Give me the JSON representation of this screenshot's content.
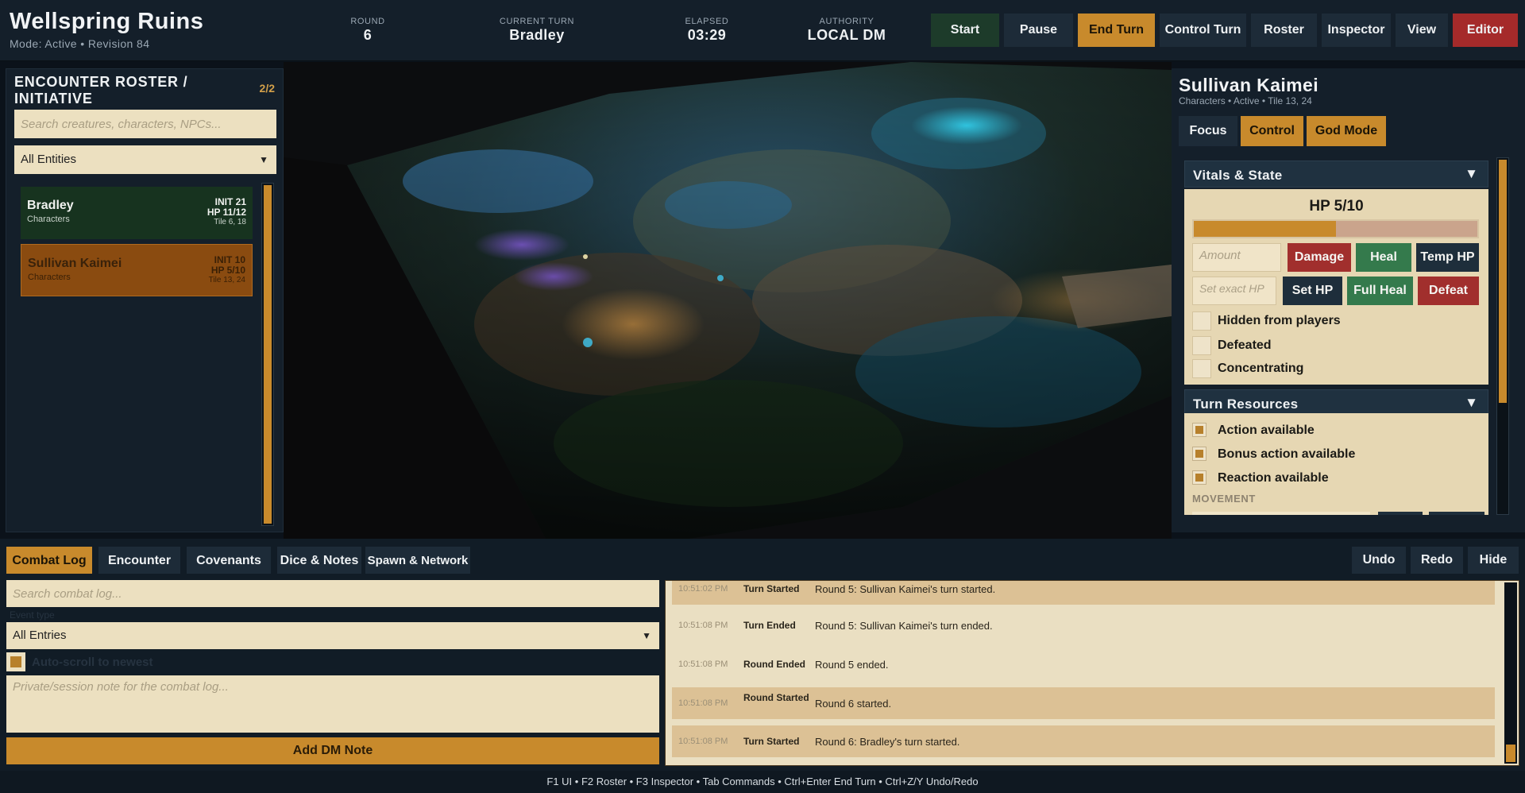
{
  "header": {
    "title": "Wellspring Ruins",
    "subtitle": "Mode: Active  •  Revision 84",
    "stats": [
      {
        "label": "ROUND",
        "value": "6"
      },
      {
        "label": "CURRENT TURN",
        "value": "Bradley"
      },
      {
        "label": "ELAPSED",
        "value": "03:29"
      },
      {
        "label": "AUTHORITY",
        "value": "LOCAL DM"
      }
    ],
    "buttons": {
      "start": "Start",
      "pause": "Pause",
      "end_turn": "End Turn",
      "control_turn": "Control Turn",
      "roster": "Roster",
      "inspector": "Inspector",
      "view": "View",
      "editor": "Editor"
    }
  },
  "roster": {
    "title": "ENCOUNTER ROSTER / INITIATIVE",
    "count": "2/2",
    "search_placeholder": "Search creatures, characters, NPCs...",
    "filter_value": "All Entities",
    "entities": [
      {
        "name": "Bradley",
        "class": "Characters",
        "init": "INIT 21",
        "hp": "HP 11/12",
        "tile": "Tile 6, 18"
      },
      {
        "name": "Sullivan Kaimei",
        "class": "Characters",
        "init": "INIT 10",
        "hp": "HP 5/10",
        "tile": "Tile 13, 24"
      }
    ]
  },
  "inspector": {
    "name": "Sullivan Kaimei",
    "subtitle": "Characters  •  Active  •  Tile 13, 24",
    "buttons": {
      "focus": "Focus",
      "control": "Control",
      "god_mode": "God Mode"
    },
    "vitals": {
      "title": "Vitals & State",
      "hp_label": "HP 5/10",
      "hp_fraction": 0.5,
      "amount_placeholder": "Amount",
      "set_hp_placeholder": "Set exact HP",
      "damage": "Damage",
      "heal": "Heal",
      "temp_hp": "Temp HP",
      "set_hp": "Set HP",
      "full_heal": "Full Heal",
      "defeat": "Defeat",
      "checks": [
        "Hidden from players",
        "Defeated",
        "Concentrating"
      ]
    },
    "resources": {
      "title": "Turn Resources",
      "items": [
        "Action available",
        "Bonus action available",
        "Reaction available"
      ],
      "movement_label": "MOVEMENT"
    }
  },
  "dock": {
    "tabs": [
      "Combat Log",
      "Encounter",
      "Covenants",
      "Dice & Notes",
      "Spawn & Network"
    ],
    "undo": "Undo",
    "redo": "Redo",
    "hide": "Hide",
    "search_placeholder": "Search combat log...",
    "event_type_label": "Event type",
    "entry_filter": "All Entries",
    "autoscroll_label": "Auto-scroll to newest",
    "note_placeholder": "Private/session note for the combat log...",
    "add_note": "Add DM Note",
    "log": [
      {
        "time": "10:51:02 PM",
        "event": "Turn Started",
        "message": "Round 5: Sullivan Kaimei's turn started.",
        "highlight": true
      },
      {
        "time": "10:51:08 PM",
        "event": "Turn Ended",
        "message": "Round 5: Sullivan Kaimei's turn ended.",
        "highlight": false
      },
      {
        "time": "10:51:08 PM",
        "event": "Round Ended",
        "message": "Round 5 ended.",
        "highlight": false
      },
      {
        "time": "10:51:08 PM",
        "event": "Round Started",
        "message": "Round 6 started.",
        "highlight": true
      },
      {
        "time": "10:51:08 PM",
        "event": "Turn Started",
        "message": "Round 6: Bradley's turn started.",
        "highlight": true
      }
    ]
  },
  "footer": "F1 UI  •  F2 Roster  •  F3 Inspector  •  Tab Commands  •  Ctrl+Enter End Turn  •  Ctrl+Z/Y Undo/Redo"
}
